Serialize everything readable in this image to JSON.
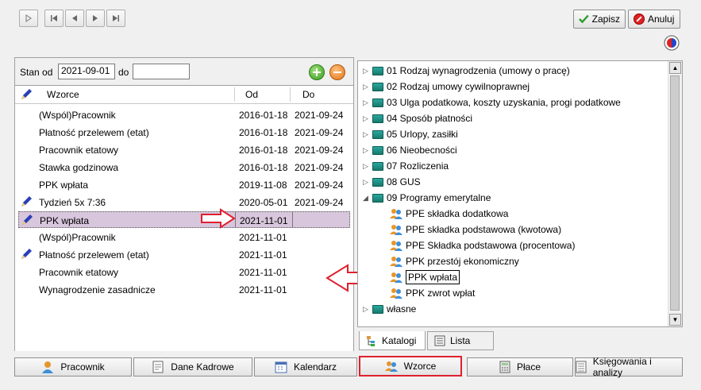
{
  "toolbar": {
    "save_label": "Zapisz",
    "cancel_label": "Anuluj"
  },
  "filter": {
    "from_label": "Stan od",
    "from_value": "2021-09-01",
    "to_label": "do",
    "to_value": ""
  },
  "grid": {
    "headers": {
      "name": "Wzorce",
      "from": "Od",
      "to": "Do"
    },
    "rows": [
      {
        "name": "(Wspól)Pracownik",
        "from": "2016-01-18",
        "to": "2021-09-24",
        "pen": false
      },
      {
        "name": "Płatność przelewem (etat)",
        "from": "2016-01-18",
        "to": "2021-09-24",
        "pen": false
      },
      {
        "name": "Pracownik etatowy",
        "from": "2016-01-18",
        "to": "2021-09-24",
        "pen": false
      },
      {
        "name": "Stawka godzinowa",
        "from": "2016-01-18",
        "to": "2021-09-24",
        "pen": false
      },
      {
        "name": "PPK wpłata",
        "from": "2019-11-08",
        "to": "2021-09-24",
        "pen": false
      },
      {
        "name": "Tydzień 5x 7:36",
        "from": "2020-05-01",
        "to": "2021-09-24",
        "pen": true
      },
      {
        "name": "PPK wpłata",
        "from": "2021-11-01",
        "to": "",
        "pen": true
      },
      {
        "name": "(Wspól)Pracownik",
        "from": "2021-11-01",
        "to": "",
        "pen": false
      },
      {
        "name": "Płatność przelewem (etat)",
        "from": "2021-11-01",
        "to": "",
        "pen": true
      },
      {
        "name": "Pracownik etatowy",
        "from": "2021-11-01",
        "to": "",
        "pen": false
      },
      {
        "name": "Wynagrodzenie zasadnicze",
        "from": "2021-11-01",
        "to": "",
        "pen": false
      }
    ]
  },
  "tree": {
    "items": [
      {
        "label": "01 Rodzaj wynagrodzenia (umowy o pracę)",
        "type": "folder",
        "expanded": false
      },
      {
        "label": "02 Rodzaj umowy cywilnoprawnej",
        "type": "folder",
        "expanded": false
      },
      {
        "label": "03 Ulga podatkowa, koszty uzyskania, progi podatkowe",
        "type": "folder",
        "expanded": false
      },
      {
        "label": "04 Sposób płatności",
        "type": "folder",
        "expanded": false
      },
      {
        "label": "05 Urlopy, zasiłki",
        "type": "folder",
        "expanded": false
      },
      {
        "label": "06 Nieobecności",
        "type": "folder",
        "expanded": false
      },
      {
        "label": "07 Rozliczenia",
        "type": "folder",
        "expanded": false
      },
      {
        "label": "08 GUS",
        "type": "folder",
        "expanded": false
      },
      {
        "label": "09 Programy emerytalne",
        "type": "folder",
        "expanded": true
      },
      {
        "label": "PPE składka dodatkowa",
        "type": "template"
      },
      {
        "label": "PPE składka podstawowa (kwotowa)",
        "type": "template"
      },
      {
        "label": "PPE Składka podstawowa (procentowa)",
        "type": "template"
      },
      {
        "label": "PPK przestój ekonomiczny",
        "type": "template"
      },
      {
        "label": "PPK wpłata",
        "type": "template",
        "selected": true
      },
      {
        "label": "PPK zwrot wpłat",
        "type": "template"
      },
      {
        "label": "własne",
        "type": "folder",
        "expanded": false
      }
    ]
  },
  "tree_tabs": [
    {
      "label": "Katalogi",
      "active": true
    },
    {
      "label": "Lista",
      "active": false
    }
  ],
  "modules": [
    {
      "label": "Pracownik"
    },
    {
      "label": "Dane Kadrowe"
    },
    {
      "label": "Kalendarz"
    },
    {
      "label": "Wzorce",
      "active": true
    },
    {
      "label": "Płace"
    },
    {
      "label": "Księgowania i analizy"
    }
  ],
  "colors": {
    "highlight_red": "#e0202e",
    "selection": "#d8c6dc",
    "accent_teal": "#167a6c"
  }
}
